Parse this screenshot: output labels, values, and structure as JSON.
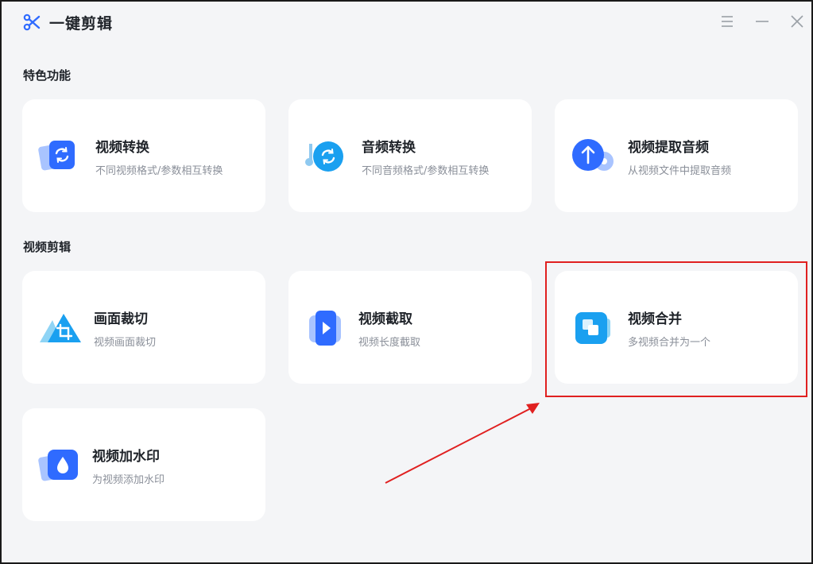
{
  "app": {
    "title": "一键剪辑",
    "logo_icon": "scissors-icon",
    "accent": "#2f6bff"
  },
  "window_controls": {
    "menu_icon": "menu-icon",
    "minimize_icon": "minimize-icon",
    "close_icon": "close-icon"
  },
  "sections": [
    {
      "title": "特色功能",
      "cards": [
        {
          "title": "视频转换",
          "desc": "不同视频格式/参数相互转换",
          "icon": "video-convert-icon"
        },
        {
          "title": "音频转换",
          "desc": "不同音频格式/参数相互转换",
          "icon": "audio-convert-icon"
        },
        {
          "title": "视频提取音频",
          "desc": "从视频文件中提取音频",
          "icon": "extract-audio-icon"
        }
      ]
    },
    {
      "title": "视频剪辑",
      "cards": [
        {
          "title": "画面裁切",
          "desc": "视频画面裁切",
          "icon": "crop-icon"
        },
        {
          "title": "视频截取",
          "desc": "视频长度截取",
          "icon": "video-trim-icon"
        },
        {
          "title": "视频合并",
          "desc": "多视频合并为一个",
          "icon": "video-merge-icon"
        },
        {
          "title": "视频加水印",
          "desc": "为视频添加水印",
          "icon": "watermark-icon"
        }
      ]
    }
  ],
  "annotation": {
    "highlight_color": "#e02020"
  }
}
